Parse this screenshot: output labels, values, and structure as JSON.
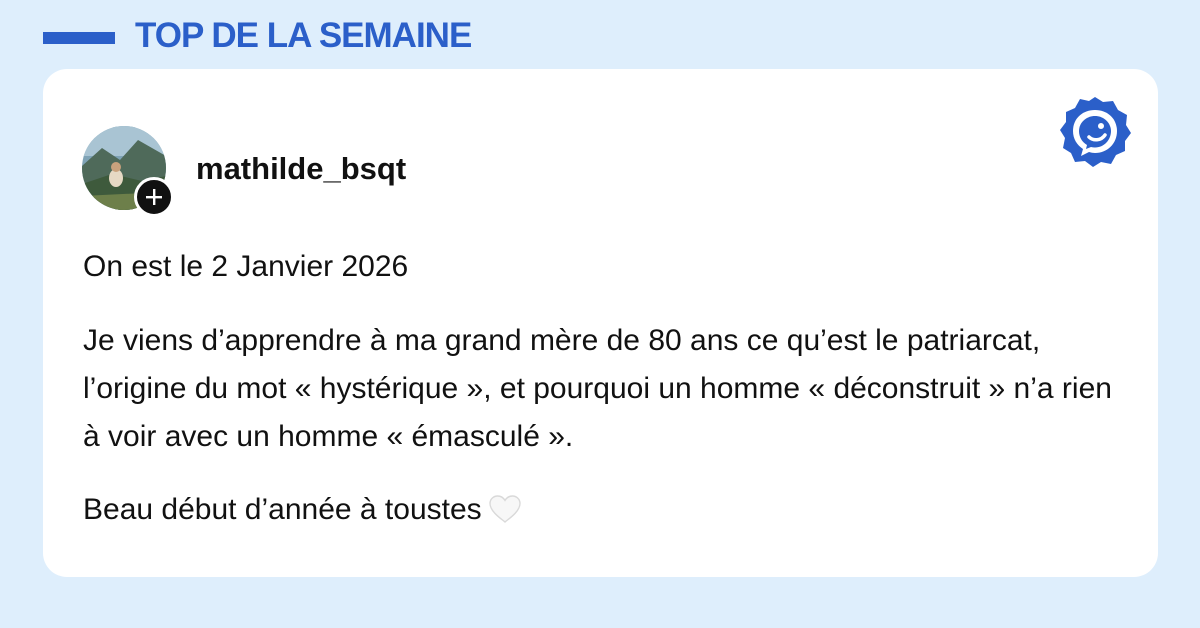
{
  "header": {
    "title": "TOP DE LA SEMAINE"
  },
  "post": {
    "username": "mathilde_bsqt",
    "paragraphs": [
      "On est le 2 Janvier 2026",
      "Je viens d’apprendre à ma grand mère de 80 ans ce qu’est le patriarcat, l’origine du mot « hystérique », et pourquoi un homme « déconstruit » n’a rien à voir avec un homme « émasculé ».",
      "Beau début d’année à toustes"
    ],
    "trailing_icon": "white-heart-icon"
  },
  "colors": {
    "page_background": "#deeefc",
    "accent": "#2b5fc9",
    "card_background": "#ffffff",
    "text": "#111111"
  },
  "icons": {
    "brand": "chat-bubble-logo-icon",
    "follow": "plus-icon"
  }
}
